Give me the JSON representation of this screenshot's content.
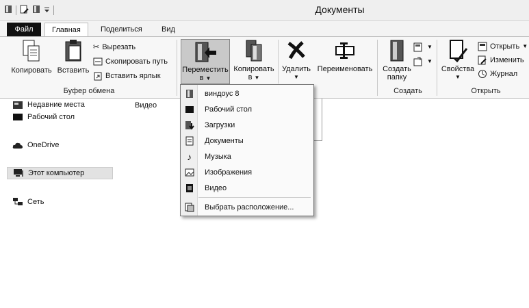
{
  "window": {
    "title": "Документы"
  },
  "tabs": {
    "file": "Файл",
    "home": "Главная",
    "share": "Поделиться",
    "view": "Вид"
  },
  "clipboard": {
    "copy": "Копировать",
    "paste": "Вставить",
    "cut": "Вырезать",
    "copy_path": "Скопировать путь",
    "paste_shortcut": "Вставить ярлык",
    "group": "Буфер обмена"
  },
  "organize": {
    "move_to": [
      "Переместить",
      "в"
    ],
    "copy_to": [
      "Копировать",
      "в"
    ],
    "delete": "Удалить",
    "rename": "Переименовать"
  },
  "create": {
    "new_folder": [
      "Создать",
      "папку"
    ],
    "group": "Создать"
  },
  "open": {
    "properties": "Свойства",
    "open": "Открыть",
    "edit": "Изменить",
    "history": "Журнал",
    "group": "Открыть"
  },
  "nav": {
    "recent": "Недавние места",
    "desktop": "Рабочий стол",
    "onedrive": "OneDrive",
    "this_pc": "Этот компьютер",
    "network": "Сеть"
  },
  "content": {
    "item": "Видео"
  },
  "menu": {
    "items": [
      "виндоус 8",
      "Рабочий стол",
      "Загрузки",
      "Документы",
      "Музыка",
      "Изображения",
      "Видео"
    ],
    "choose": "Выбрать расположение..."
  }
}
